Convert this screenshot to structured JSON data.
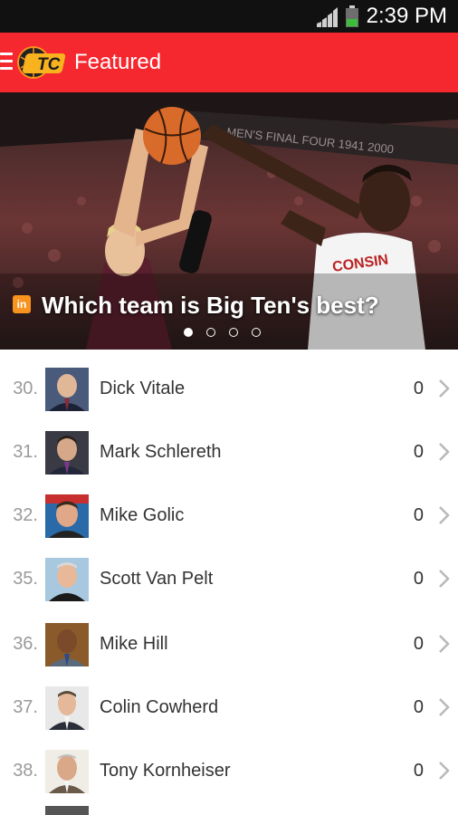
{
  "status_bar": {
    "time": "2:39 PM"
  },
  "app_bar": {
    "title": "Featured",
    "logo_text": "TC",
    "accent_color": "#f5272f"
  },
  "hero": {
    "caption": "Which team is Big Ten's best?",
    "caption_icon": "in",
    "banner_text": "MEN'S FINAL FOUR 1941 2000",
    "jersey_text": "CONSIN",
    "slides_total": 4,
    "active_slide": 1
  },
  "list": [
    {
      "rank": "30.",
      "name": "Dick Vitale",
      "score": "0"
    },
    {
      "rank": "31.",
      "name": "Mark Schlereth",
      "score": "0"
    },
    {
      "rank": "32.",
      "name": "Mike Golic",
      "score": "0"
    },
    {
      "rank": "35.",
      "name": "Scott Van Pelt",
      "score": "0"
    },
    {
      "rank": "36.",
      "name": "Mike Hill",
      "score": "0"
    },
    {
      "rank": "37.",
      "name": "Colin Cowherd",
      "score": "0"
    },
    {
      "rank": "38.",
      "name": "Tony Kornheiser",
      "score": "0"
    }
  ]
}
